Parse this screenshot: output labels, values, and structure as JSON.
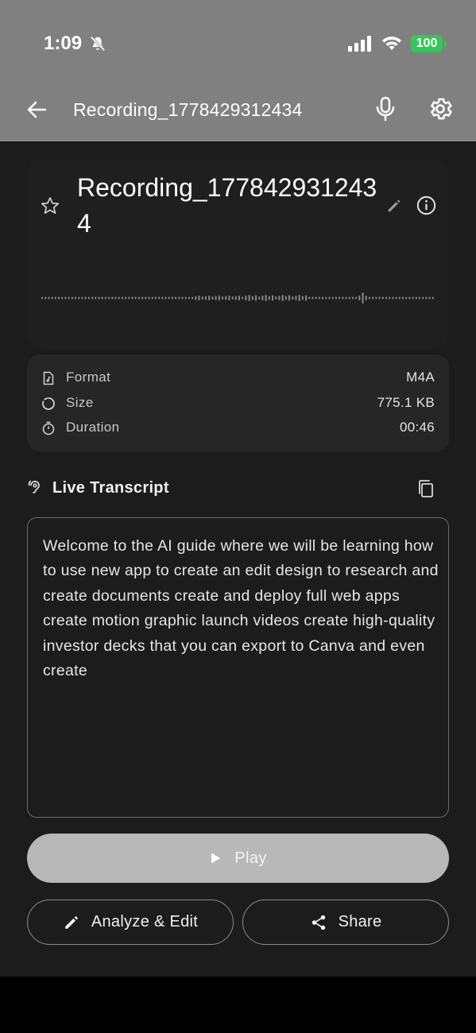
{
  "status_bar": {
    "time": "1:09",
    "battery": "100",
    "icons": [
      "bell-off-icon",
      "signal-icon",
      "wifi-icon",
      "battery-icon"
    ],
    "battery_color": "#34c759"
  },
  "app_bar": {
    "title": "Recording_1778429312434",
    "icons": [
      "back-arrow-icon",
      "microphone-icon",
      "gear-icon"
    ],
    "background": "#808080"
  },
  "recording": {
    "title": "Recording_1778429312434",
    "icons": [
      "star-icon",
      "pencil-icon",
      "info-icon"
    ]
  },
  "metadata": [
    {
      "label": "Format",
      "value": "M4A",
      "icon": "audio-file-icon"
    },
    {
      "label": "Size",
      "value": "775.1 KB",
      "icon": "progress-circle-icon"
    },
    {
      "label": "Duration",
      "value": "00:46",
      "icon": "timer-icon"
    }
  ],
  "transcript": {
    "heading": "Live Transcript",
    "text": "Welcome to the AI guide where we will be learning how to use new app to create an edit design to research and create documents create and deploy full web apps create motion graphic launch videos create high-quality investor decks that you can export to Canva and even create",
    "icons": [
      "hearing-icon",
      "copy-icon"
    ]
  },
  "actions": {
    "play": "Play",
    "analyze": "Analyze & Edit",
    "share": "Share"
  }
}
